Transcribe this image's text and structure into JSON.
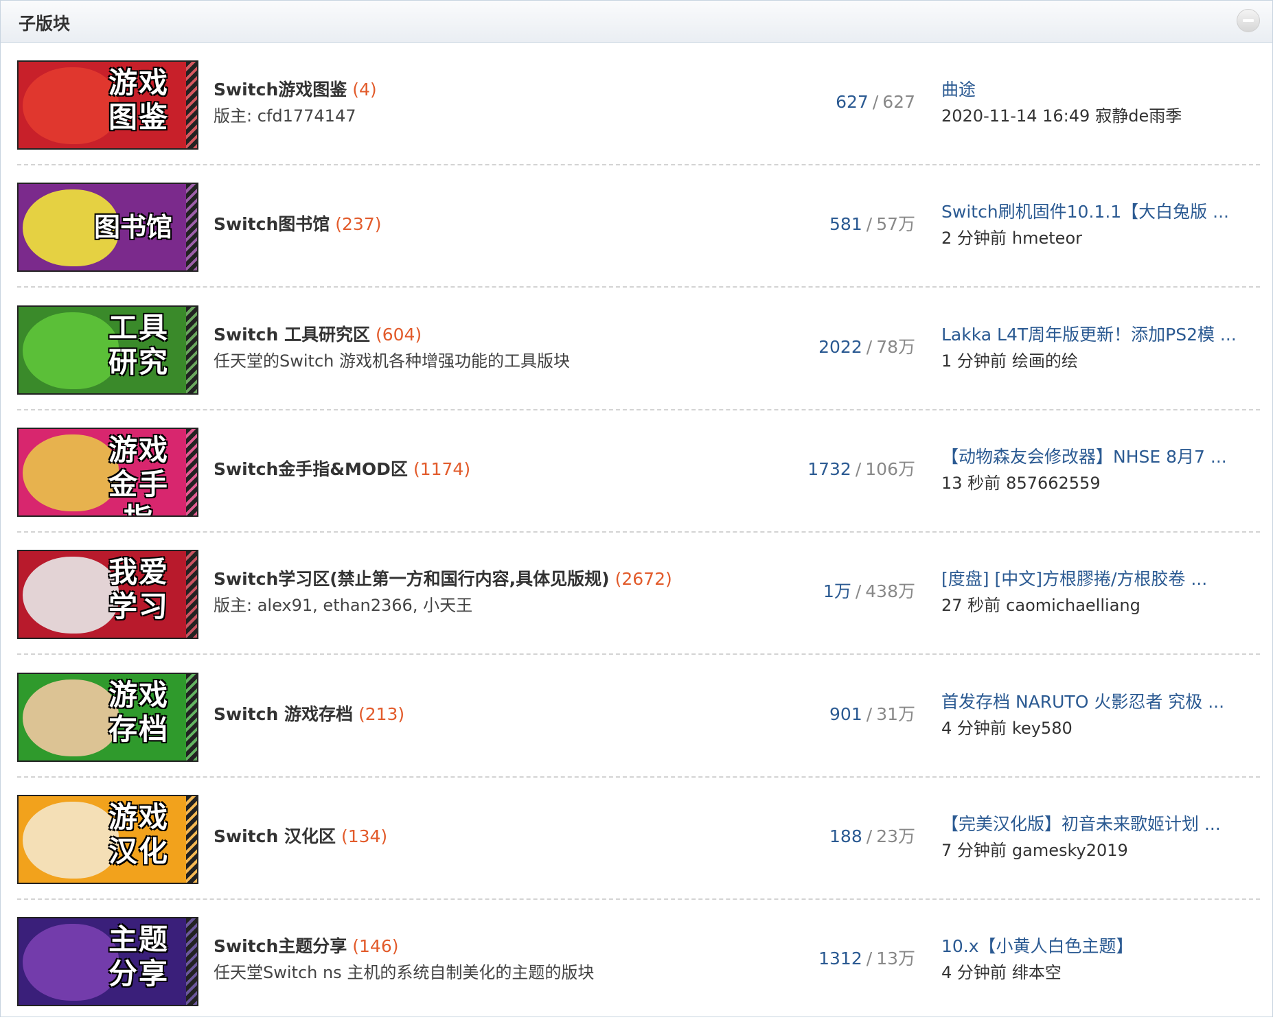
{
  "header": {
    "title": "子版块"
  },
  "forums": [
    {
      "name": "Switch游戏图鉴",
      "today": "(4)",
      "desc": "版主: cfd1774147",
      "threads": "627",
      "posts": "627",
      "latest_title": "曲途",
      "latest_time": "2020-11-14 16:49",
      "latest_author": "寂静de雨季",
      "thumb_text": "游戏图鉴",
      "thumb_bg": "#c8202a",
      "thumb_char": "#e23a2f",
      "thumb_icon": "mario-icon"
    },
    {
      "name": "Switch图书馆",
      "today": "(237)",
      "desc": "",
      "threads": "581",
      "posts": "57万",
      "latest_title": "Switch刷机固件10.1.1【大白兔版 ...",
      "latest_time": "2 分钟前",
      "latest_author": "hmeteor",
      "thumb_text": "图书馆",
      "thumb_bg": "#7b2a8c",
      "thumb_char": "#f1e33a",
      "thumb_icon": "wario-icon"
    },
    {
      "name": "Switch 工具研究区",
      "today": "(604)",
      "desc": "任天堂的Switch 游戏机各种增强功能的工具版块",
      "threads": "2022",
      "posts": "78万",
      "latest_title": "Lakka L4T周年版更新！添加PS2模 ...",
      "latest_time": "1 分钟前",
      "latest_author": "绘画的绘",
      "thumb_text": "工具研究",
      "thumb_bg": "#3a8a2a",
      "thumb_char": "#5fc43a",
      "thumb_icon": "yoshi-icon"
    },
    {
      "name": "Switch金手指&MOD区",
      "today": "(1174)",
      "desc": "",
      "threads": "1732",
      "posts": "106万",
      "latest_title": "【动物森友会修改器】NHSE 8月7 ...",
      "latest_time": "13 秒前",
      "latest_author": "857662559",
      "thumb_text": "游戏金手指",
      "thumb_bg": "#d8266e",
      "thumb_char": "#e9c24a",
      "thumb_icon": "bowser-jr-icon"
    },
    {
      "name": "Switch学习区(禁止第一方和国行内容,具体见版规)",
      "today": "(2672)",
      "desc": "版主: alex91, ethan2366, 小天王",
      "threads": "1万",
      "posts": "438万",
      "latest_title": "[度盘] [中文]方根膠捲/方根胶卷 ...",
      "latest_time": "27 秒前",
      "latest_author": "caomichaelliang",
      "thumb_text": "我爱学习",
      "thumb_bg": "#b81a2c",
      "thumb_char": "#e8e8e8",
      "thumb_icon": "shy-guy-icon"
    },
    {
      "name": "Switch 游戏存档",
      "today": "(213)",
      "desc": "",
      "threads": "901",
      "posts": "31万",
      "latest_title": "首发存档 NARUTO 火影忍者 究极 ...",
      "latest_time": "4 分钟前",
      "latest_author": "key580",
      "thumb_text": "游戏存档",
      "thumb_bg": "#2f9a2c",
      "thumb_char": "#f0c8a0",
      "thumb_icon": "luigi-icon"
    },
    {
      "name": "Switch 汉化区",
      "today": "(134)",
      "desc": "",
      "threads": "188",
      "posts": "23万",
      "latest_title": "【完美汉化版】初音未来歌姬计划 ...",
      "latest_time": "7 分钟前",
      "latest_author": "gamesky2019",
      "thumb_text": "游戏汉化",
      "thumb_bg": "#f2a21c",
      "thumb_char": "#f4e6c8",
      "thumb_icon": "toad-icon"
    },
    {
      "name": "Switch主题分享",
      "today": "(146)",
      "desc": "任天堂Switch ns 主机的系统自制美化的主题的版块",
      "threads": "1312",
      "posts": "13万",
      "latest_title": "10.x【小黄人白色主题】",
      "latest_time": "4 分钟前",
      "latest_author": "绯本空",
      "thumb_text": "主题分享",
      "thumb_bg": "#3a1f7a",
      "thumb_char": "#7a3fb0",
      "thumb_icon": "waluigi-icon"
    }
  ]
}
